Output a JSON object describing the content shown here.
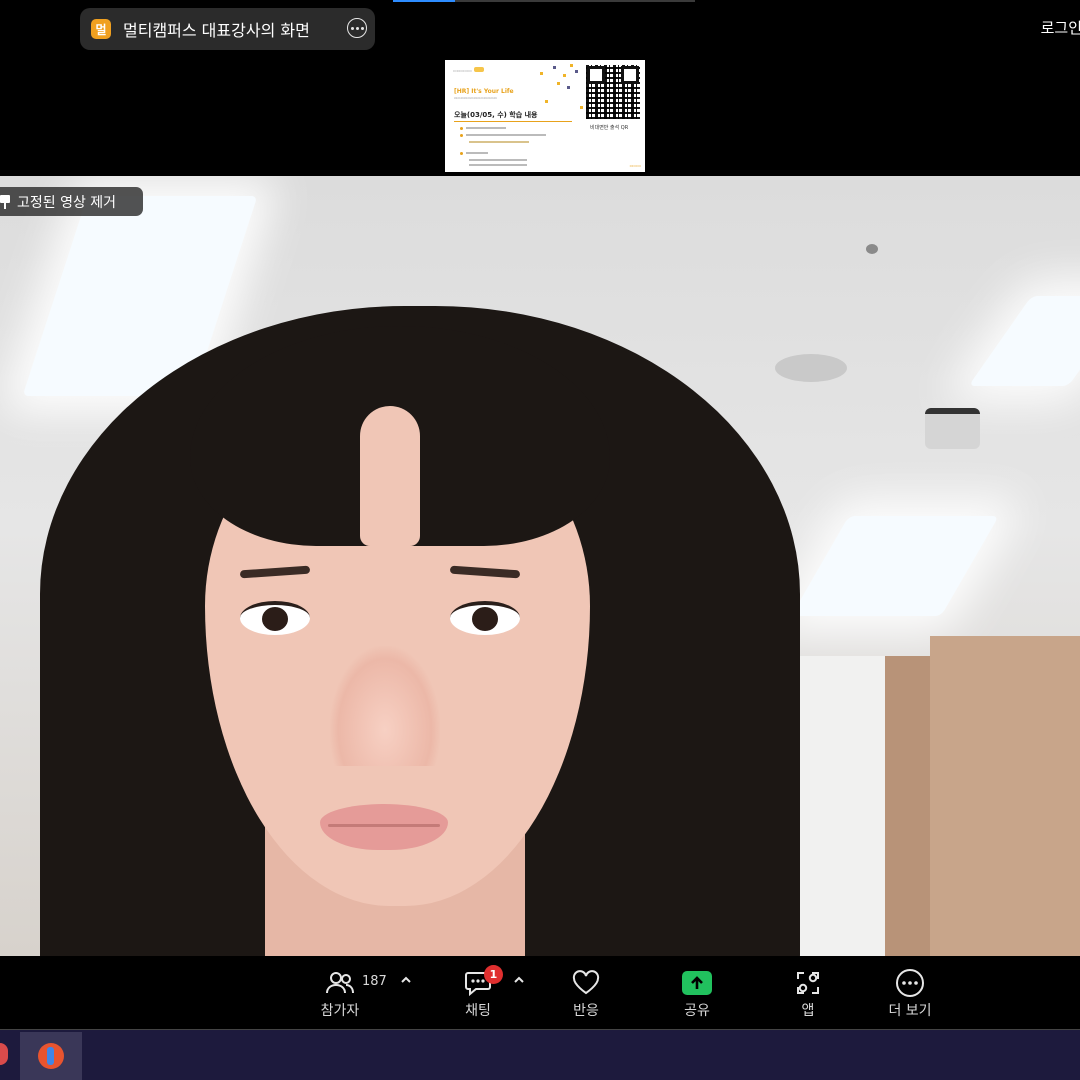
{
  "top_bar": {
    "share_badge_letter": "멀",
    "share_title": "멀티캠퍼스 대표강사의 화면",
    "more_icon": "ellipsis-circle-icon",
    "login_label": "로그인"
  },
  "slide": {
    "title": "[HR] It's Your Life",
    "heading": "오늘(03/05, 수) 학습 내용",
    "qr_label": "비대면반 출석 QR"
  },
  "video": {
    "pinned_label": "고정된 영상 제거"
  },
  "toolbar": {
    "participants_label": "참가자",
    "participants_count": "187",
    "chat_label": "채팅",
    "chat_badge": "1",
    "reactions_label": "반응",
    "share_label": "공유",
    "apps_label": "앱",
    "more_label": "더 보기"
  },
  "colors": {
    "share_green": "#21c15e",
    "badge_red": "#e02f2f",
    "taskbar": "#1d1a3d"
  }
}
